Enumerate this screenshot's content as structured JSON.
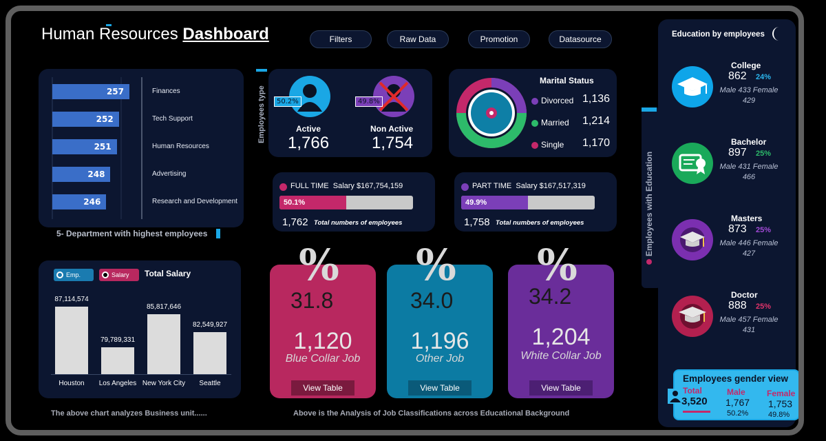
{
  "header": {
    "title_regular": "Human Resources",
    "title_bold": "Dashboard"
  },
  "nav": {
    "filters": "Filters",
    "raw_data": "Raw Data",
    "promotion": "Promotion",
    "datasource": "Datasource"
  },
  "departments": {
    "caption": "5- Department with highest employees",
    "items": [
      {
        "name": "Finances",
        "value": "257",
        "count": 257
      },
      {
        "name": "Tech Support",
        "value": "252",
        "count": 252
      },
      {
        "name": "Human Resources",
        "value": "251",
        "count": 251
      },
      {
        "name": "Advertising",
        "value": "248",
        "count": 248
      },
      {
        "name": "Research and Development",
        "value": "246",
        "count": 246
      }
    ]
  },
  "employees_type": {
    "side_label": "Employees type",
    "active_label": "Active",
    "active_value": "1,766",
    "active_pct": "50.2%",
    "inactive_label": "Non Active",
    "inactive_value": "1,754",
    "inactive_pct": "49.8%"
  },
  "marital": {
    "title": "Marital Status",
    "items": [
      {
        "label": "Divorced",
        "value": "1,136",
        "color": "#7b3fb8"
      },
      {
        "label": "Married",
        "value": "1,214",
        "color": "#2dbb6a"
      },
      {
        "label": "Single",
        "value": "1,170",
        "color": "#c4286a"
      }
    ]
  },
  "full_time": {
    "label": "FULL TIME",
    "salary": "Salary $167,754,159",
    "pct": "50.1%",
    "pct_fraction": 0.501,
    "count": "1,762",
    "caption": "Total numbers of employees",
    "color": "#c4286a"
  },
  "part_time": {
    "label": "PART TIME",
    "salary": "Salary $167,517,319",
    "pct": "49.9%",
    "pct_fraction": 0.499,
    "count": "1,758",
    "caption": "Total numbers of employees",
    "color": "#7b3fb8"
  },
  "total_salary": {
    "title": "Total Salary",
    "legend_emp": "Emp.",
    "legend_salary": "Salary",
    "footer": "The above chart analyzes Business unit......"
  },
  "chart_data": {
    "type": "bar",
    "title": "Total Salary",
    "categories": [
      "Houston",
      "Los Angeles",
      "New York City",
      "Seattle"
    ],
    "values": [
      87114574,
      79789331,
      85817646,
      82549927
    ],
    "value_labels": [
      "87,114,574",
      "79,789,331",
      "85,817,646",
      "82,549,927"
    ],
    "ylim": [
      75000000,
      88000000
    ],
    "grid": false
  },
  "jobs": {
    "footer": "Above is the Analysis of Job Classifications across Educational Background",
    "items": [
      {
        "symbol": "%",
        "pct": "31.8",
        "count": "1,120",
        "label": "Blue Collar Job",
        "button": "View Table",
        "color": "#b8285f"
      },
      {
        "symbol": "%",
        "pct": "34.0",
        "count": "1,196",
        "label": "Other Job",
        "button": "View Table",
        "color": "#0c7ba3"
      },
      {
        "symbol": "%",
        "pct": "34.2",
        "count": "1,204",
        "label": "White Collar Job",
        "button": "View Table",
        "color": "#6a2d9a"
      }
    ]
  },
  "education": {
    "title": "Education by employees",
    "side_label": "Employees with Education",
    "items": [
      {
        "name": "College",
        "count": "862",
        "pct": "24%",
        "detail": "Male 433 Female 429",
        "color": "#0ea5e9",
        "pct_color": "#2bb6ef"
      },
      {
        "name": "Bachelor",
        "count": "897",
        "pct": "25%",
        "detail": "Male 431 Female 466",
        "color": "#1aa95a",
        "pct_color": "#2dbb6a"
      },
      {
        "name": "Masters",
        "count": "873",
        "pct": "25%",
        "detail": "Male 446 Female 427",
        "color": "#7b2fb0",
        "pct_color": "#a24ad6"
      },
      {
        "name": "Doctor",
        "count": "888",
        "pct": "25%",
        "detail": "Male 457 Female 431",
        "color": "#b3204f",
        "pct_color": "#e0336a"
      }
    ]
  },
  "gender": {
    "title": "Employees gender view",
    "total_label": "Total",
    "total_value": "3,520",
    "male_label": "Male",
    "male_value": "1,767",
    "male_pct": "50.2%",
    "female_label": "Female",
    "female_value": "1,753",
    "female_pct": "49.8%"
  }
}
